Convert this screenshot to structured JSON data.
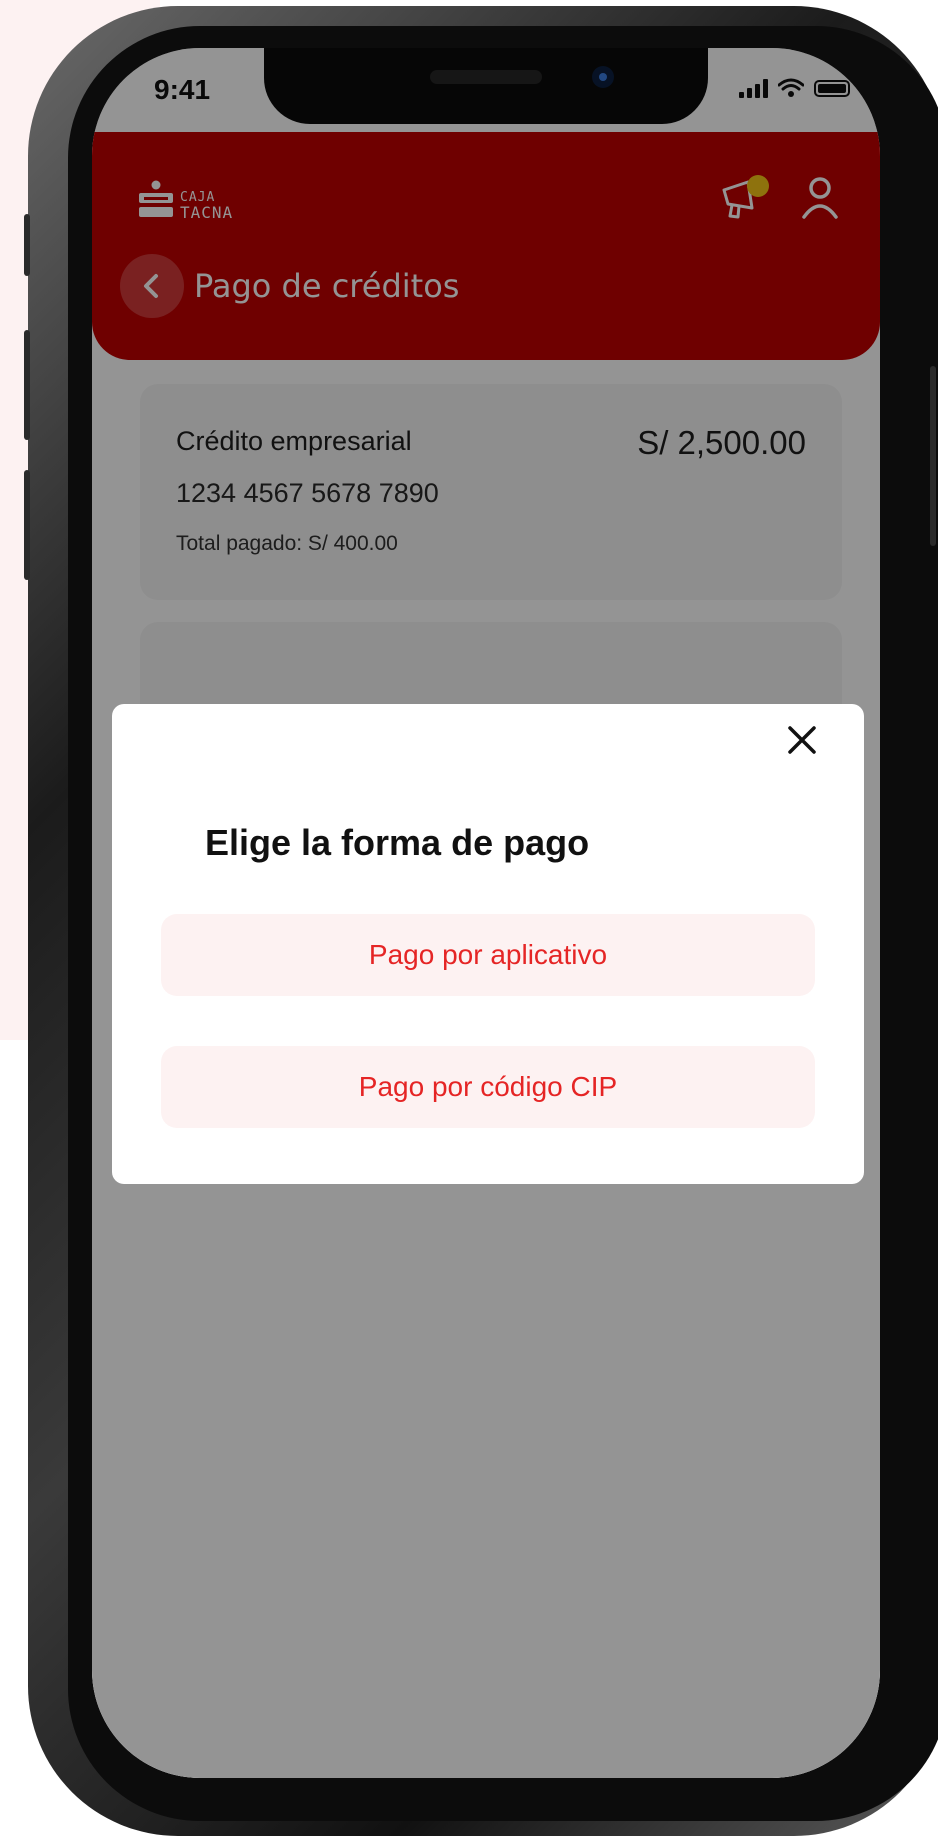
{
  "status_bar": {
    "time": "9:41"
  },
  "header": {
    "logo_line1": "CAJA",
    "logo_line2": "TACNA",
    "page_title": "Pago de créditos"
  },
  "credit": {
    "type": "Crédito empresarial",
    "number": "1234 4567 5678 7890",
    "total_paid": "Total pagado: S/ 400.00",
    "amount": "S/ 2,500.00"
  },
  "modal": {
    "title": "Elige la forma de pago",
    "options": [
      {
        "label": "Pago por aplicativo"
      },
      {
        "label": "Pago por código CIP"
      }
    ]
  },
  "colors": {
    "brand_red": "#c00000",
    "option_text": "#e52525",
    "option_bg": "#fdf2f2",
    "notification_dot": "#f5c518"
  },
  "icons": [
    "back-chevron-icon",
    "megaphone-icon",
    "user-icon",
    "close-icon",
    "signal-icon",
    "wifi-icon",
    "battery-icon"
  ]
}
